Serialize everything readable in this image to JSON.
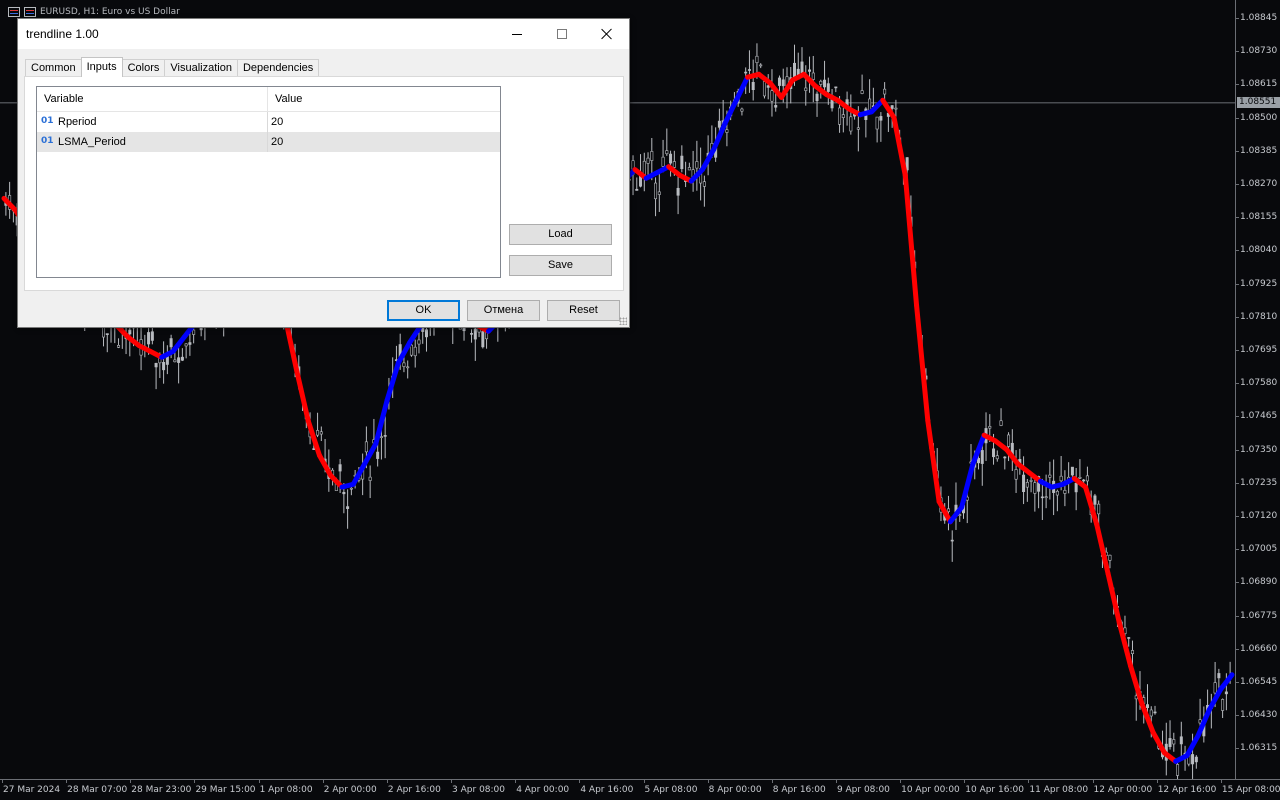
{
  "chart": {
    "header": "EURUSD, H1:  Euro vs US Dollar",
    "current_price": "1.08551",
    "colors": {
      "background": "#08090c",
      "candles": "#b9bcc1",
      "trend_up": "#0000ff",
      "trend_down": "#ff0000"
    },
    "price_axis": [
      {
        "label": "1.08845",
        "price": 1.08845
      },
      {
        "label": "1.08730",
        "price": 1.0873
      },
      {
        "label": "1.08615",
        "price": 1.08615
      },
      {
        "label": "1.08500",
        "price": 1.085
      },
      {
        "label": "1.08385",
        "price": 1.08385
      },
      {
        "label": "1.08270",
        "price": 1.0827
      },
      {
        "label": "1.08155",
        "price": 1.08155
      },
      {
        "label": "1.08040",
        "price": 1.0804
      },
      {
        "label": "1.07925",
        "price": 1.07925
      },
      {
        "label": "1.07810",
        "price": 1.0781
      },
      {
        "label": "1.07695",
        "price": 1.07695
      },
      {
        "label": "1.07580",
        "price": 1.0758
      },
      {
        "label": "1.07465",
        "price": 1.07465
      },
      {
        "label": "1.07350",
        "price": 1.0735
      },
      {
        "label": "1.07235",
        "price": 1.07235
      },
      {
        "label": "1.07120",
        "price": 1.0712
      },
      {
        "label": "1.07005",
        "price": 1.07005
      },
      {
        "label": "1.06890",
        "price": 1.0689
      },
      {
        "label": "1.06775",
        "price": 1.06775
      },
      {
        "label": "1.06660",
        "price": 1.0666
      },
      {
        "label": "1.06545",
        "price": 1.06545
      },
      {
        "label": "1.06430",
        "price": 1.0643
      },
      {
        "label": "1.06315",
        "price": 1.06315
      }
    ],
    "time_axis": [
      "27 Mar 2024",
      "28 Mar 07:00",
      "28 Mar 23:00",
      "29 Mar 15:00",
      "1 Apr 08:00",
      "2 Apr 00:00",
      "2 Apr 16:00",
      "3 Apr 08:00",
      "4 Apr 00:00",
      "4 Apr 16:00",
      "5 Apr 08:00",
      "8 Apr 00:00",
      "8 Apr 16:00",
      "9 Apr 08:00",
      "10 Apr 00:00",
      "10 Apr 16:00",
      "11 Apr 08:00",
      "12 Apr 00:00",
      "12 Apr 16:00",
      "15 Apr 08:00"
    ],
    "trend_series": [
      1.0822,
      1.0818,
      1.0812,
      1.0806,
      1.08,
      1.0794,
      1.079,
      1.0786,
      1.0783,
      1.078,
      1.0778,
      1.0774,
      1.0771,
      1.0769,
      1.0767,
      1.0769,
      1.0774,
      1.0779,
      1.0783,
      1.0786,
      1.079,
      1.0793,
      1.0795,
      1.0796,
      1.0792,
      1.078,
      1.0762,
      1.0745,
      1.0733,
      1.0726,
      1.0722,
      1.0723,
      1.073,
      1.0737,
      1.0752,
      1.0765,
      1.0772,
      1.0778,
      1.0783,
      1.0786,
      1.0784,
      1.0781,
      1.0778,
      1.0776,
      1.078,
      1.079,
      1.0803,
      1.0812,
      1.0818,
      1.0822,
      1.0826,
      1.0824,
      1.0819,
      1.0822,
      1.0826,
      1.0828,
      1.0832,
      1.0829,
      1.0831,
      1.0833,
      1.083,
      1.0828,
      1.0832,
      1.0839,
      1.0848,
      1.0856,
      1.0864,
      1.0865,
      1.0862,
      1.0857,
      1.0863,
      1.0865,
      1.0861,
      1.0858,
      1.0856,
      1.0853,
      1.0851,
      1.0852,
      1.0856,
      1.085,
      1.083,
      1.0785,
      1.0745,
      1.0717,
      1.071,
      1.0715,
      1.073,
      1.074,
      1.0738,
      1.0735,
      1.073,
      1.0727,
      1.0724,
      1.0722,
      1.0723,
      1.0725,
      1.0722,
      1.0709,
      1.0692,
      1.0675,
      1.066,
      1.0647,
      1.0637,
      1.063,
      1.0627,
      1.0629,
      1.0636,
      1.0645,
      1.0652,
      1.0657
    ],
    "trend_direction": [
      "down",
      "down",
      "down",
      "down",
      "down",
      "down",
      "down",
      "down",
      "down",
      "down",
      "down",
      "down",
      "down",
      "down",
      "down",
      "up",
      "up",
      "up",
      "up",
      "up",
      "up",
      "up",
      "up",
      "up",
      "down",
      "down",
      "down",
      "down",
      "down",
      "down",
      "down",
      "up",
      "up",
      "up",
      "up",
      "up",
      "up",
      "up",
      "up",
      "up",
      "down",
      "down",
      "down",
      "down",
      "up",
      "up",
      "up",
      "up",
      "up",
      "up",
      "up",
      "down",
      "down",
      "up",
      "up",
      "up",
      "up",
      "down",
      "up",
      "up",
      "down",
      "down",
      "up",
      "up",
      "up",
      "up",
      "up",
      "down",
      "down",
      "down",
      "down",
      "down",
      "down",
      "down",
      "down",
      "down",
      "down",
      "up",
      "up",
      "down",
      "down",
      "down",
      "down",
      "down",
      "down",
      "up",
      "up",
      "up",
      "down",
      "down",
      "down",
      "down",
      "down",
      "up",
      "up",
      "up",
      "down",
      "down",
      "down",
      "down",
      "down",
      "down",
      "down",
      "down",
      "down",
      "up",
      "up",
      "up",
      "up",
      "up"
    ]
  },
  "dialog": {
    "title": "trendline 1.00",
    "tabs": [
      "Common",
      "Inputs",
      "Colors",
      "Visualization",
      "Dependencies"
    ],
    "active_tab": "Inputs",
    "grid": {
      "columns": [
        "Variable",
        "Value"
      ],
      "rows": [
        {
          "icon": "01",
          "name": "Rperiod",
          "value": "20"
        },
        {
          "icon": "01",
          "name": "LSMA_Period",
          "value": "20"
        }
      ]
    },
    "buttons": {
      "load": "Load",
      "save": "Save",
      "ok": "OK",
      "cancel": "Отмена",
      "reset": "Reset"
    }
  }
}
